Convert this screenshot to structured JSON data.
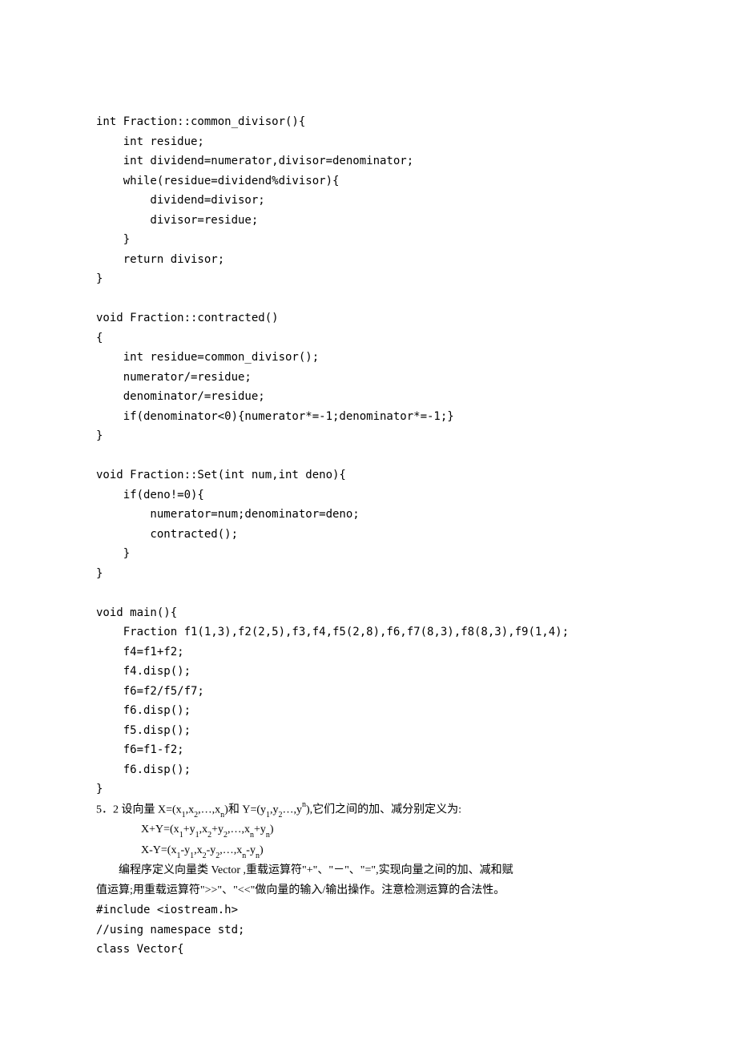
{
  "code": {
    "fn1_sig": "int Fraction::common_divisor(){",
    "fn1_l1": "    int residue;",
    "fn1_l2": "    int dividend=numerator,divisor=denominator;",
    "fn1_l3": "    while(residue=dividend%divisor){",
    "fn1_l4": "        dividend=divisor;",
    "fn1_l5": "        divisor=residue;",
    "fn1_l6": "    }",
    "fn1_l7": "    return divisor;",
    "fn1_end": "}",
    "fn2_sig": "void Fraction::contracted()",
    "fn2_open": "{",
    "fn2_l1": "    int residue=common_divisor();",
    "fn2_l2": "    numerator/=residue;",
    "fn2_l3": "    denominator/=residue;",
    "fn2_l4": "    if(denominator<0){numerator*=-1;denominator*=-1;}",
    "fn2_end": "}",
    "fn3_sig": "void Fraction::Set(int num,int deno){",
    "fn3_l1": "    if(deno!=0){",
    "fn3_l2": "        numerator=num;denominator=deno;",
    "fn3_l3": "        contracted();",
    "fn3_l4": "    }",
    "fn3_end": "}",
    "fn4_sig": "void main(){",
    "fn4_l1": "    Fraction f1(1,3),f2(2,5),f3,f4,f5(2,8),f6,f7(8,3),f8(8,3),f9(1,4);",
    "fn4_l2": "    f4=f1+f2;",
    "fn4_l3": "    f4.disp();",
    "fn4_l4": "    f6=f2/f5/f7;",
    "fn4_l5": "    f6.disp();",
    "fn4_l6": "    f5.disp();",
    "fn4_l7": "    f6=f1-f2;",
    "fn4_l8": "    f6.disp();",
    "fn4_end": "}"
  },
  "problem": {
    "p1_prefix": "5．2 设向量 X=(x",
    "p1_s1": "1",
    "p1_m1": ",x",
    "p1_s2": "2",
    "p1_m2": ",…,x",
    "p1_s3": "n",
    "p1_m3": ")和 Y=(y",
    "p1_s4": "1",
    "p1_m4": ",y",
    "p1_s5": "2",
    "p1_m5": "…,y",
    "p1_sup": "n",
    "p1_suffix": "),它们之间的加、减分别定义为:",
    "p2_prefix": "X+Y=(x",
    "p2_s1": "1",
    "p2_m1": "+y",
    "p2_s2": "1",
    "p2_m2": ",x",
    "p2_s3": "2",
    "p2_m3": "+y",
    "p2_s4": "2",
    "p2_m4": ",…,x",
    "p2_s5": "n",
    "p2_m5": "+y",
    "p2_s6": "n",
    "p2_suffix": ")",
    "p3_prefix": "X-Y=(x",
    "p3_s1": "1",
    "p3_m1": "-y",
    "p3_s2": "1",
    "p3_m2": ",x",
    "p3_s3": "2",
    "p3_m3": "-y",
    "p3_s4": "2",
    "p3_m4": ",…,x",
    "p3_s5": "n",
    "p3_m5": "-y",
    "p3_s6": "n",
    "p3_suffix": ")",
    "desc1": "　　编程序定义向量类 Vector ,重载运算符\"+\"、\"－\"、\"=\",实现向量之间的加、减和赋",
    "desc2": "值运算;用重载运算符\">>\"、\"<<\"做向量的输入/输出操作。注意检测运算的合法性。"
  },
  "tail": {
    "inc": "#include <iostream.h>",
    "ns": "//using namespace std;",
    "cls": "class Vector{"
  }
}
